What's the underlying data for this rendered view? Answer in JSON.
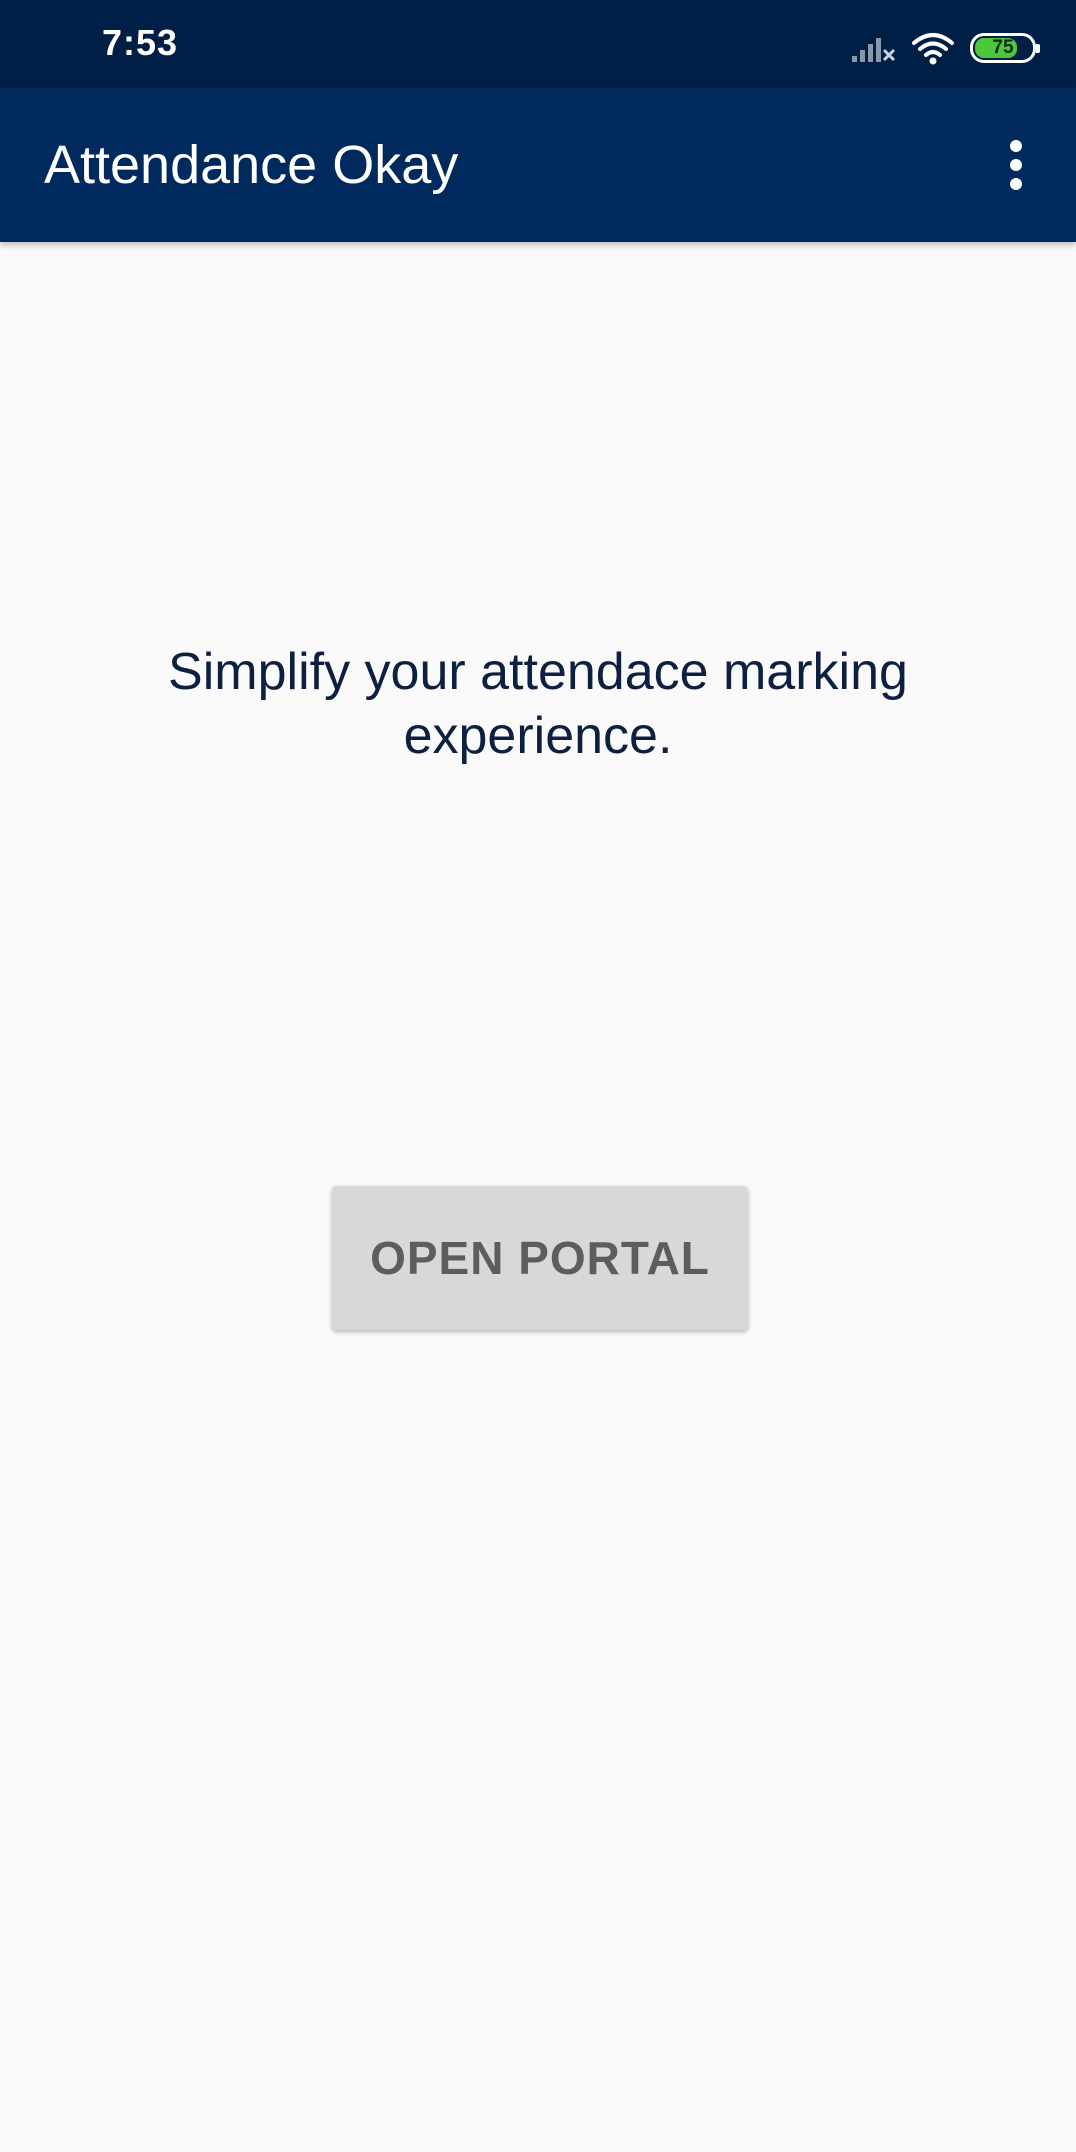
{
  "status_bar": {
    "time": "7:53",
    "icons": [
      "signal-no-service-icon",
      "wifi-icon",
      "battery-icon"
    ],
    "battery_level": "75",
    "battery_color": "#4cc73b",
    "background": "#001f47"
  },
  "app_bar": {
    "title": "Attendance Okay",
    "menu_icon": "more-vert-icon",
    "background": "#002a5e"
  },
  "main": {
    "tagline": "Simplify your attendace marking experience.",
    "open_portal_label": "OPEN PORTAL"
  }
}
